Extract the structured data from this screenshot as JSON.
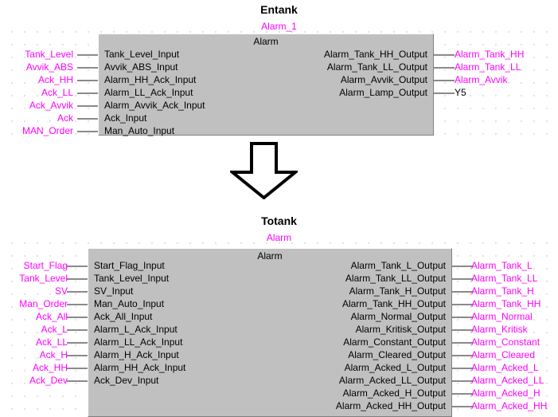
{
  "diagram": {
    "title_top": "Entank",
    "title_bottom": "Totank",
    "arrow_icon": "down-arrow-icon",
    "colors": {
      "block_fill": "#c0c0c0",
      "variable_text": "#ff00ff",
      "port_text": "#000000",
      "wire": "#8a8a8a",
      "grid_dot": "#8a8a8a",
      "background": "#ffffff"
    }
  },
  "entank": {
    "title": "Entank",
    "instance_name": "Alarm_1",
    "block_type": "Alarm",
    "inputs": [
      {
        "variable": "Tank_Level",
        "port": "Tank_Level_Input"
      },
      {
        "variable": "Avvik_ABS",
        "port": "Avvik_ABS_Input"
      },
      {
        "variable": "Ack_HH",
        "port": "Alarm_HH_Ack_Input"
      },
      {
        "variable": "Ack_LL",
        "port": "Alarm_LL_Ack_Input"
      },
      {
        "variable": "Ack_Avvik",
        "port": "Alarm_Avvik_Ack_Input"
      },
      {
        "variable": "Ack",
        "port": "Ack_Input"
      },
      {
        "variable": "MAN_Order",
        "port": "Man_Auto_Input"
      }
    ],
    "outputs": [
      {
        "port": "Alarm_Tank_HH_Output",
        "variable": "Alarm_Tank_HH",
        "style": "variable"
      },
      {
        "port": "Alarm_Tank_LL_Output",
        "variable": "Alarm_Tank_LL",
        "style": "variable"
      },
      {
        "port": "Alarm_Avvik_Output",
        "variable": "Alarm_Avvik",
        "style": "variable"
      },
      {
        "port": "Alarm_Lamp_Output",
        "variable": "Y5",
        "style": "address"
      }
    ]
  },
  "totank": {
    "title": "Totank",
    "instance_name": "Alarm",
    "block_type": "Alarm",
    "inputs": [
      {
        "variable": "Start_Flag",
        "port": "Start_Flag_Input"
      },
      {
        "variable": "Tank_Level",
        "port": "Tank_Level_Input"
      },
      {
        "variable": "SV",
        "port": "SV_Input"
      },
      {
        "variable": "Man_Order",
        "port": "Man_Auto_Input"
      },
      {
        "variable": "Ack_All",
        "port": "Ack_All_Input"
      },
      {
        "variable": "Ack_L",
        "port": "Alarm_L_Ack_Input"
      },
      {
        "variable": "Ack_LL",
        "port": "Alarm_LL_Ack_Input"
      },
      {
        "variable": "Ack_H",
        "port": "Alarm_H_Ack_Input"
      },
      {
        "variable": "Ack_HH",
        "port": "Alarm_HH_Ack_Input"
      },
      {
        "variable": "Ack_Dev",
        "port": "Ack_Dev_Input"
      }
    ],
    "outputs": [
      {
        "port": "Alarm_Tank_L_Output",
        "variable": "Alarm_Tank_L",
        "style": "variable"
      },
      {
        "port": "Alarm_Tank_LL_Output",
        "variable": "Alarm_Tank_LL",
        "style": "variable"
      },
      {
        "port": "Alarm_Tank_H_Output",
        "variable": "Alarm_Tank_H",
        "style": "variable"
      },
      {
        "port": "Alarm_Tank_HH_Output",
        "variable": "Alarm_Tank_HH",
        "style": "variable"
      },
      {
        "port": "Alarm_Normal_Output",
        "variable": "Alarm_Normal",
        "style": "variable"
      },
      {
        "port": "Alarm_Kritisk_Output",
        "variable": "Alarm_Kritisk",
        "style": "variable"
      },
      {
        "port": "Alarm_Constant_Output",
        "variable": "Alarm_Constant",
        "style": "variable"
      },
      {
        "port": "Alarm_Cleared_Output",
        "variable": "Alarm_Cleared",
        "style": "variable"
      },
      {
        "port": "Alarm_Acked_L_Output",
        "variable": "Alarm_Acked_L",
        "style": "variable"
      },
      {
        "port": "Alarm_Acked_LL_Output",
        "variable": "Alarm_Acked_LL",
        "style": "variable"
      },
      {
        "port": "Alarm_Acked_H_Output",
        "variable": "Alarm_Acked_H",
        "style": "variable"
      },
      {
        "port": "Alarm_Acked_HH_Output",
        "variable": "Alarm_Acked_HH",
        "style": "variable"
      }
    ]
  }
}
